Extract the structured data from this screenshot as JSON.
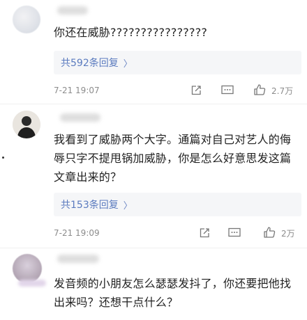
{
  "comments": [
    {
      "text": "你还在威胁????????????????",
      "replies_label": "共592条回复",
      "time": "7-21 19:07",
      "likes": "2.7万"
    },
    {
      "text": "我看到了威胁两个大字。通篇对自己对艺人的侮辱只字不提甩锅加威胁，你是怎么好意思发这篇文章出来的？",
      "replies_label": "共153条回复",
      "time": "7-21 19:09",
      "likes": "2万"
    },
    {
      "text": "发音频的小朋友怎么瑟瑟发抖了，你还要把他找出来吗？还想干点什么？"
    }
  ],
  "icons": {
    "share": "share-icon",
    "comment": "comment-icon",
    "like": "thumbs-up-icon",
    "chevron": "chevron-right-icon"
  },
  "colors": {
    "link": "#5b7bbf",
    "reply_bg": "#f5f6f8",
    "meta": "#8c8c8c"
  }
}
